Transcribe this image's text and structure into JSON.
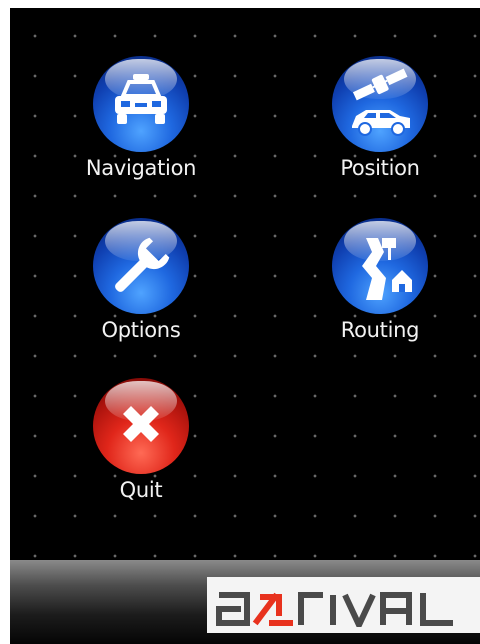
{
  "menu": {
    "items": [
      {
        "id": "navigation",
        "label": "Navigation",
        "icon": "car-icon"
      },
      {
        "id": "position",
        "label": "Position",
        "icon": "satellite-car-icon"
      },
      {
        "id": "options",
        "label": "Options",
        "icon": "wrench-icon"
      },
      {
        "id": "routing",
        "label": "Routing",
        "icon": "route-map-icon"
      },
      {
        "id": "quit",
        "label": "Quit",
        "icon": "close-icon"
      }
    ]
  },
  "brand": {
    "logo_text": "a-rival",
    "logo_text_parts": [
      "a",
      "RIVAL"
    ],
    "accent_color": "#e8321e",
    "logo_color": "#4a4a4a"
  },
  "colors": {
    "screen_background": "#000000",
    "orb_blue": "#1f68e0",
    "orb_red": "#e0261a",
    "label_color": "#f2f2f2"
  }
}
